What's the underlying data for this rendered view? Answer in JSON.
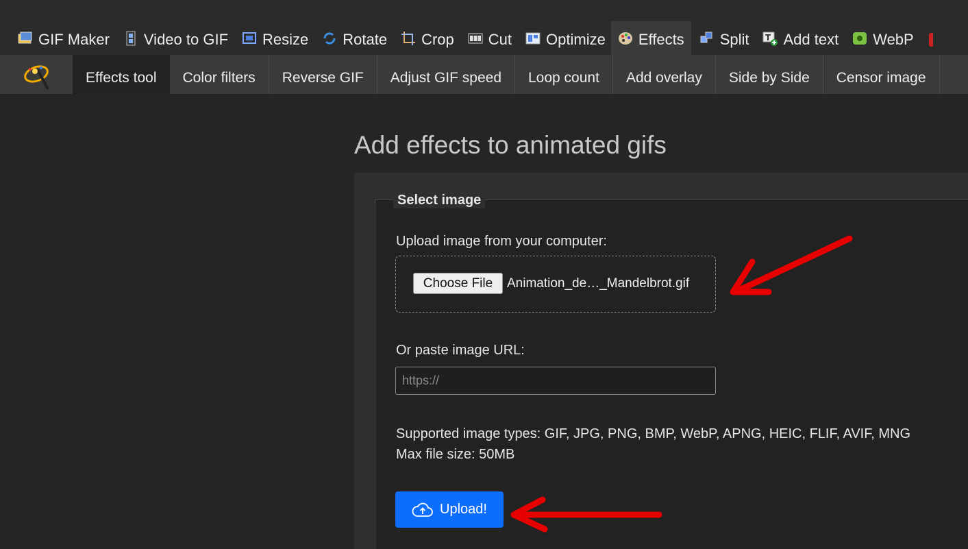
{
  "top_nav": {
    "items": [
      {
        "label": "GIF Maker",
        "icon": "gif-maker-icon"
      },
      {
        "label": "Video to GIF",
        "icon": "film-strip-icon"
      },
      {
        "label": "Resize",
        "icon": "resize-icon"
      },
      {
        "label": "Rotate",
        "icon": "rotate-icon"
      },
      {
        "label": "Crop",
        "icon": "crop-icon"
      },
      {
        "label": "Cut",
        "icon": "cut-icon"
      },
      {
        "label": "Optimize",
        "icon": "optimize-icon"
      },
      {
        "label": "Effects",
        "icon": "palette-icon",
        "active": true
      },
      {
        "label": "Split",
        "icon": "split-icon"
      },
      {
        "label": "Add text",
        "icon": "add-text-icon"
      },
      {
        "label": "WebP",
        "icon": "webp-icon"
      }
    ]
  },
  "sub_nav": {
    "tabs": [
      {
        "label": "Effects tool",
        "active": true
      },
      {
        "label": "Color filters"
      },
      {
        "label": "Reverse GIF"
      },
      {
        "label": "Adjust GIF speed"
      },
      {
        "label": "Loop count"
      },
      {
        "label": "Add overlay"
      },
      {
        "label": "Side by Side"
      },
      {
        "label": "Censor image"
      }
    ]
  },
  "main": {
    "title": "Add effects to animated gifs",
    "section_legend": "Select image",
    "upload_label": "Upload image from your computer:",
    "choose_file_label": "Choose File",
    "selected_file": "Animation_de…_Mandelbrot.gif",
    "url_label": "Or paste image URL:",
    "url_placeholder": "https://",
    "url_value": "",
    "supported_types": "Supported image types: GIF, JPG, PNG, BMP, WebP, APNG, HEIC, FLIF, AVIF, MNG",
    "max_size": "Max file size: 50MB",
    "upload_button": "Upload!"
  },
  "colors": {
    "accent": "#0d6efd",
    "annotation_arrow": "#e60000",
    "background": "#252525"
  }
}
